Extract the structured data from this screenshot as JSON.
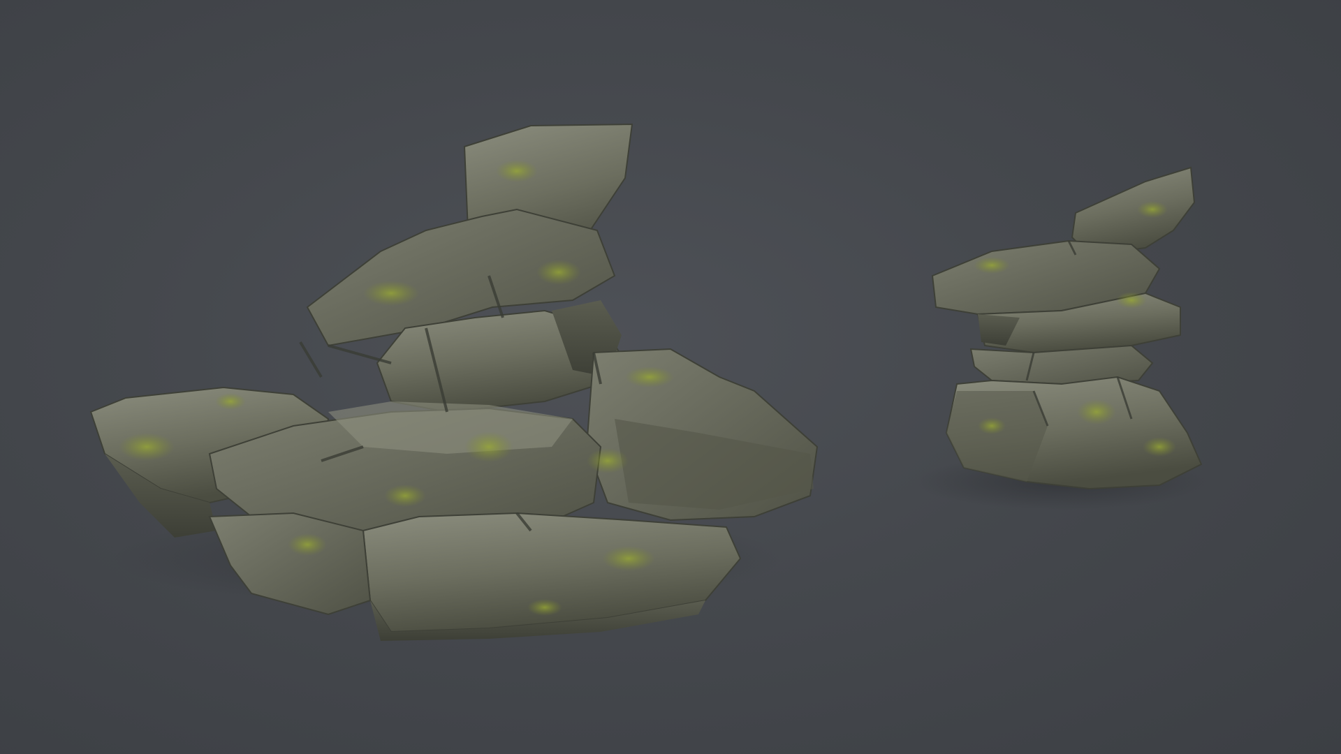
{
  "scene": {
    "background_color": "#45484d",
    "subjects": [
      {
        "name": "large-rock-formation",
        "stone_color": "#6e705f",
        "moss_color": "#8a9a2e"
      },
      {
        "name": "small-rock-formation",
        "stone_color": "#6e705f",
        "moss_color": "#8a9a2e"
      }
    ]
  }
}
